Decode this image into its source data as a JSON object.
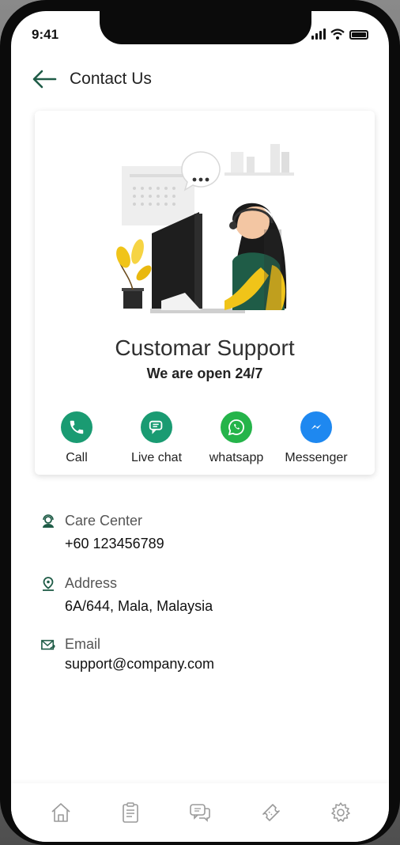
{
  "status_bar": {
    "time": "9:41"
  },
  "header": {
    "title": "Contact Us",
    "back_icon": "arrow-left-icon"
  },
  "card": {
    "title": "Customar Support",
    "subtitle": "We are open 24/7",
    "channels": [
      {
        "label": "Call",
        "icon": "phone-icon",
        "color": "#1a9b72"
      },
      {
        "label": "Live chat",
        "icon": "chat-icon",
        "color": "#1a9b72"
      },
      {
        "label": "whatsapp",
        "icon": "whatsapp-icon",
        "color": "#25b44a"
      },
      {
        "label": "Messenger",
        "icon": "messenger-icon",
        "color": "#1e88f0"
      }
    ]
  },
  "contact_info": [
    {
      "label": "Care Center",
      "value": "+60 123456789",
      "icon": "agent-icon"
    },
    {
      "label": "Address",
      "value": "6A/644, Mala, Malaysia",
      "icon": "location-pin-icon"
    },
    {
      "label": "Email",
      "value": "support@company.com",
      "icon": "envelope-icon"
    }
  ],
  "bottom_nav": [
    {
      "icon": "home-icon"
    },
    {
      "icon": "clipboard-icon"
    },
    {
      "icon": "chat-bubbles-icon"
    },
    {
      "icon": "ticket-icon"
    },
    {
      "icon": "gear-icon"
    }
  ],
  "colors": {
    "accent": "#1f5c47",
    "nav_icon": "#9a9a9a"
  }
}
